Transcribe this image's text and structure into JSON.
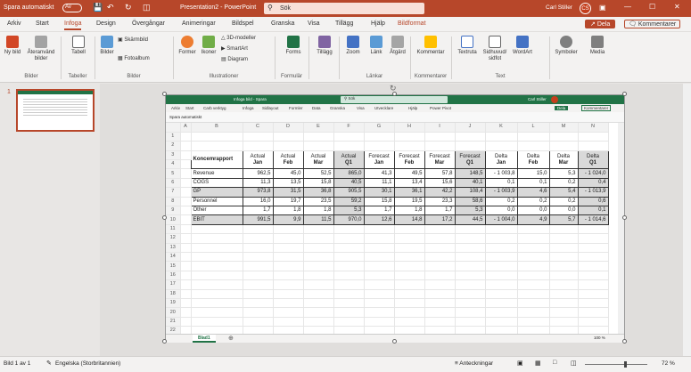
{
  "titlebar": {
    "autosave_label": "Spara automatiskt",
    "autosave_state": "Av",
    "doc_title": "Presentation2 - PowerPoint",
    "search_placeholder": "Sök",
    "user_name": "Carl Stiller",
    "user_initials": "CS"
  },
  "ribbon_tabs": [
    "Arkiv",
    "Start",
    "Infoga",
    "Design",
    "Övergångar",
    "Animeringar",
    "Bildspel",
    "Granska",
    "Visa",
    "Tillägg",
    "Hjälp",
    "Bildformat"
  ],
  "active_tab": "Infoga",
  "share_label": "Dela",
  "comments_label": "Kommentarer",
  "ribbon": {
    "new_slide": "Ny bild",
    "reuse_slides": "Återanvänd bilder",
    "table": "Tabell",
    "pictures": "Bilder",
    "screenshot": "Skärmbild",
    "photo_album": "Fotoalbum",
    "shapes": "Former",
    "icons": "Ikoner",
    "models_3d": "3D-modeller",
    "smartart": "SmartArt",
    "chart": "Diagram",
    "forms": "Forms",
    "addins": "Tillägg",
    "zoom": "Zoom",
    "link": "Länk",
    "action": "Åtgärd",
    "comment": "Kommentar",
    "textbox": "Textruta",
    "header_footer": "Sidhuvud/ sidfot",
    "wordart": "WordArt",
    "symbols": "Symboler",
    "media": "Media"
  },
  "ribbon_groups": [
    "Bilder",
    "Tabeller",
    "Bilder",
    "Illustrationer",
    "Formulär",
    "Länkar",
    "Kommentarer",
    "Text"
  ],
  "thumb_number": "1",
  "excel": {
    "title": "Infoga bild - Spara",
    "search": "Sök",
    "user": "Carl Stiller",
    "tabs": [
      "Arkiv",
      "Start",
      "Carb verktyg",
      "Infoga",
      "Sidlayout",
      "Formler",
      "Data",
      "Granska",
      "Visa",
      "Utvecklare",
      "Hjälp",
      "Power Pivot"
    ],
    "share": "Dela",
    "comments": "Kommentarer",
    "autosave": "Spara automatiskt",
    "columns": [
      "A",
      "B",
      "C",
      "D",
      "E",
      "F",
      "G",
      "H",
      "I",
      "J",
      "K",
      "L",
      "M",
      "N"
    ],
    "rows": [
      "1",
      "2",
      "3",
      "4",
      "5",
      "6",
      "7",
      "8",
      "9",
      "10",
      "11",
      "12",
      "13",
      "14",
      "15",
      "16",
      "17",
      "18",
      "19",
      "20",
      "21",
      "22"
    ],
    "report_title": "Koncemrapport",
    "headers": [
      [
        "Actual",
        "Jan"
      ],
      [
        "Actual",
        "Feb"
      ],
      [
        "Actual",
        "Mar"
      ],
      [
        "Actual",
        "Q1"
      ],
      [
        "Forecast",
        "Jan"
      ],
      [
        "Forecast",
        "Feb"
      ],
      [
        "Forecast",
        "Mar"
      ],
      [
        "Forecast",
        "Q1"
      ],
      [
        "Delta",
        "Jan"
      ],
      [
        "Delta",
        "Feb"
      ],
      [
        "Delta",
        "Mar"
      ],
      [
        "Delta",
        "Q1"
      ]
    ],
    "data": [
      {
        "label": "Revenue",
        "dash": "",
        "vals": [
          "962,5",
          "45,0",
          "52,5",
          "865,0",
          "41,3",
          "49,5",
          "57,8",
          "148,5",
          "- 1 003,8",
          "15,0",
          "5,3",
          "- 1 024,0"
        ],
        "shade": false
      },
      {
        "label": "COGS",
        "dash": "",
        "vals": [
          "11,3",
          "13,5",
          "15,8",
          "40,5",
          "11,1",
          "13,4",
          "15,6",
          "40,1",
          "0,1",
          "0,1",
          "0,2",
          "0,4"
        ],
        "shade": false
      },
      {
        "label": "GP",
        "dash": "-",
        "vals": [
          "973,8",
          "31,5",
          "36,8",
          "905,5",
          "30,1",
          "36,1",
          "42,2",
          "108,4",
          "- 1 003,9",
          "4,6",
          "5,4",
          "- 1 013,9"
        ],
        "shade": true
      },
      {
        "label": "Personnel",
        "dash": "",
        "vals": [
          "16,0",
          "19,7",
          "23,5",
          "59,2",
          "15,8",
          "19,5",
          "23,3",
          "58,6",
          "0,2",
          "0,2",
          "0,2",
          "0,6"
        ],
        "shade": false
      },
      {
        "label": "Other",
        "dash": "",
        "vals": [
          "1,7",
          "1,8",
          "1,8",
          "5,3",
          "1,7",
          "1,8",
          "1,7",
          "5,3",
          "0,0",
          "0,0",
          "0,0",
          "0,1"
        ],
        "shade": false
      },
      {
        "label": "EBIT",
        "dash": "-",
        "vals": [
          "991,5",
          "9,9",
          "11,5",
          "970,0",
          "12,6",
          "14,8",
          "17,2",
          "44,5",
          "- 1 004,0",
          "4,9",
          "5,7",
          "- 1 014,6"
        ],
        "shade": true
      }
    ],
    "sheet_tab": "Blad1",
    "zoom": "100 %"
  },
  "status": {
    "slide_info": "Bild 1 av 1",
    "language": "Engelska (Storbritannien)",
    "notes": "Anteckningar",
    "zoom": "72 %"
  }
}
